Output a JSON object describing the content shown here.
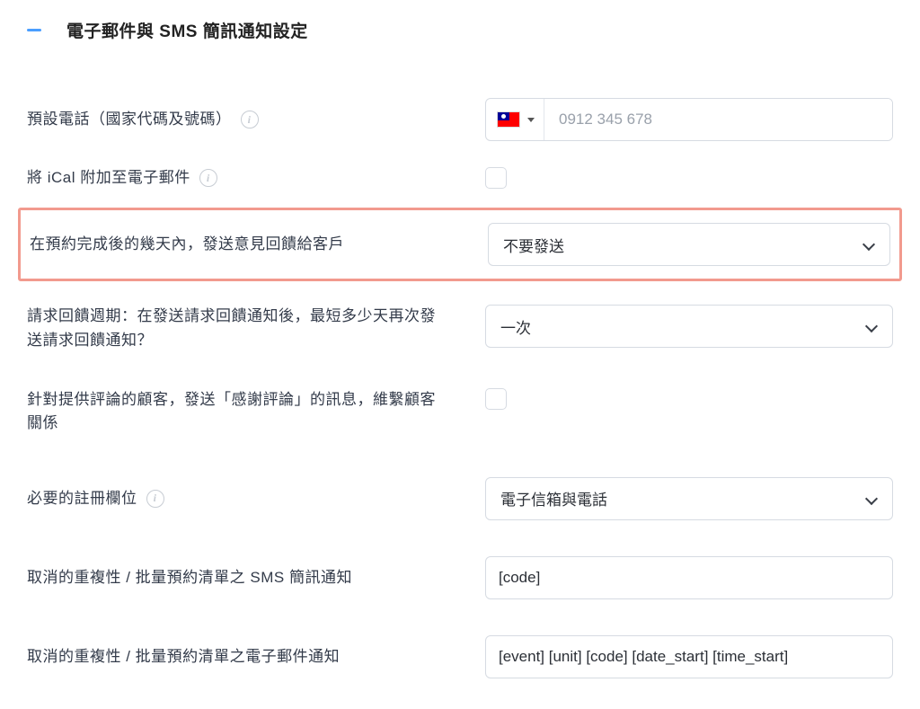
{
  "section": {
    "title": "電子郵件與 SMS 簡訊通知設定"
  },
  "fields": {
    "default_phone": {
      "label": "預設電話（國家代碼及號碼）",
      "placeholder": "0912 345 678",
      "country_icon": "flag-taiwan"
    },
    "attach_ical": {
      "label": "將 iCal 附加至電子郵件"
    },
    "feedback_after": {
      "label": "在預約完成後的幾天內，發送意見回饋給客戶",
      "value": "不要發送"
    },
    "feedback_period": {
      "label": "請求回饋週期：在發送請求回饋通知後，最短多少天再次發送請求回饋通知？",
      "value": "一次"
    },
    "thank_review": {
      "label": "針對提供評論的顧客，發送「感謝評論」的訊息，維繫顧客關係"
    },
    "required_fields": {
      "label": "必要的註冊欄位",
      "value": "電子信箱與電話"
    },
    "cancel_sms": {
      "label": "取消的重複性 / 批量預約清單之 SMS 簡訊通知",
      "value": "[code]"
    },
    "cancel_email": {
      "label": "取消的重複性 / 批量預約清單之電子郵件通知",
      "value": "[event] [unit] [code] [date_start] [time_start]"
    }
  }
}
